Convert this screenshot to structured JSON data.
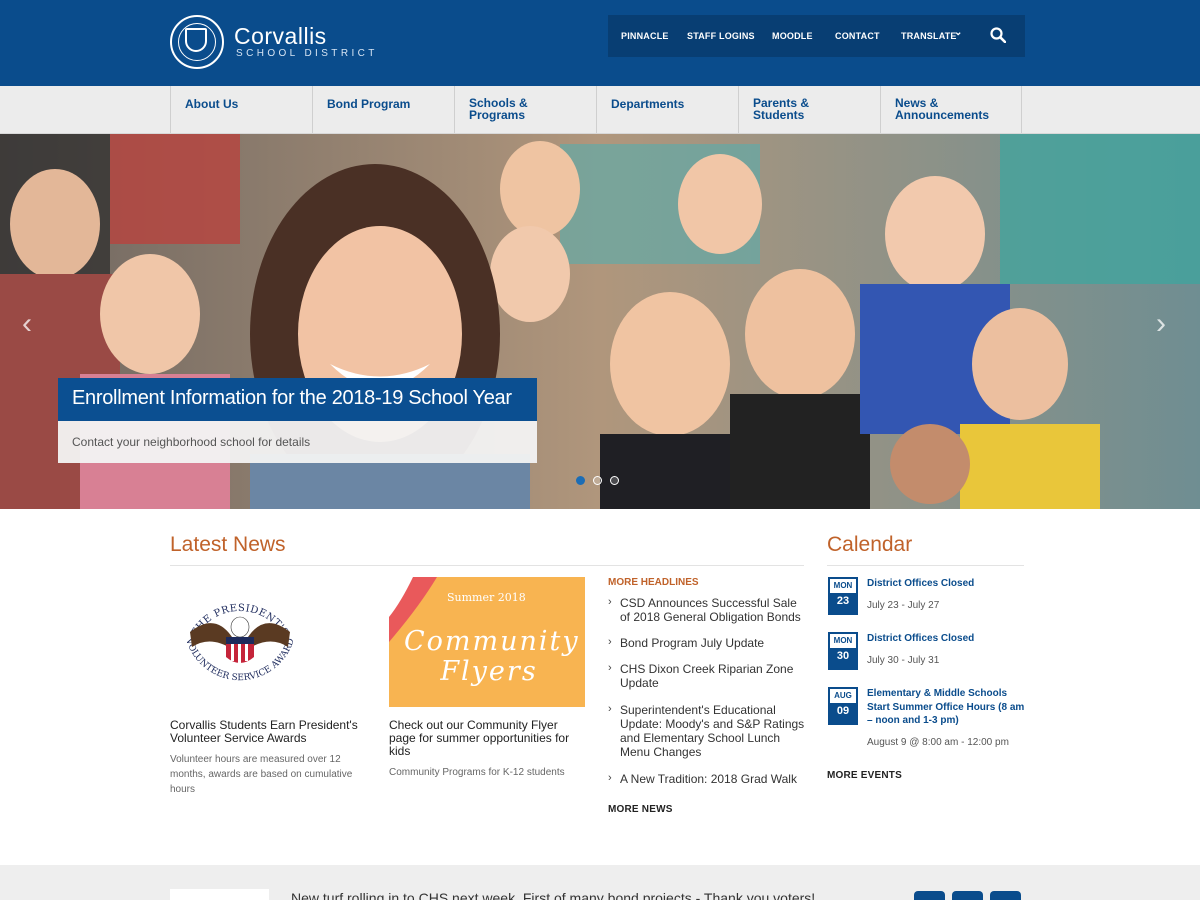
{
  "header": {
    "brand_name": "Corvallis",
    "brand_sub": "SCHOOL DISTRICT",
    "utility_links": [
      "PINNACLE",
      "STAFF LOGINS",
      "MOODLE",
      "CONTACT",
      "TRANSLATE"
    ],
    "translate_chevron": "⌄",
    "search_icon": "search-icon"
  },
  "nav": {
    "items": [
      "About Us",
      "Bond Program",
      "Schools & Programs",
      "Departments",
      "Parents & Students",
      "News & Announcements"
    ]
  },
  "hero": {
    "title": "Enrollment Information for the 2018-19 School Year",
    "subtitle": "Contact your neighborhood school for details",
    "prev_arrow": "‹",
    "next_arrow": "›",
    "slide_count": 3,
    "active_slide": 1
  },
  "news": {
    "heading": "Latest News",
    "cards": [
      {
        "title": "Corvallis Students Earn President's Volunteer Service Awards",
        "summary": "Volunteer hours are measured over 12 months, awards are based on cumulative hours",
        "image_text_top": "THE PRESIDENT'S",
        "image_text_bottom": "VOLUNTEER SERVICE AWARD"
      },
      {
        "title": "Check out our Community Flyer page for summer opportunities for kids",
        "summary": "Community Programs for K-12 students",
        "image_small": "Summer 2018",
        "image_big": "Community Flyers"
      }
    ],
    "more_headlines_label": "MORE HEADLINES",
    "headlines": [
      "CSD Announces Successful Sale of 2018 General Obligation Bonds",
      "Bond Program July Update",
      "CHS Dixon Creek Riparian Zone Update",
      "Superintendent's Educational Update: Moody's and S&P Ratings and Elementary School Lunch Menu Changes",
      "A New Tradition: 2018 Grad Walk"
    ],
    "more_news_label": "MORE NEWS"
  },
  "calendar": {
    "heading": "Calendar",
    "events": [
      {
        "day": "MON",
        "num": "23",
        "title": "District Offices Closed",
        "date": "July 23 - July 27"
      },
      {
        "day": "MON",
        "num": "30",
        "title": "District Offices Closed",
        "date": "July 30 - July 31"
      },
      {
        "day": "AUG",
        "num": "09",
        "title": "Elementary & Middle Schools Start Summer Office Hours (8 am – noon and 1-3 pm)",
        "date": "August 9 @ 8:00 am - 12:00 pm"
      }
    ],
    "more_events_label": "MORE EVENTS"
  },
  "footer": {
    "ticker": "New turf rolling in to CHS next week. First of many bond projects - Thank you voters!",
    "social_icons": [
      "twitter-icon",
      "facebook-icon",
      "linkedin-icon"
    ]
  },
  "colors": {
    "brand_blue": "#0a4c8c",
    "accent_orange": "#c0622a",
    "flyer_yellow": "#f8b451"
  }
}
